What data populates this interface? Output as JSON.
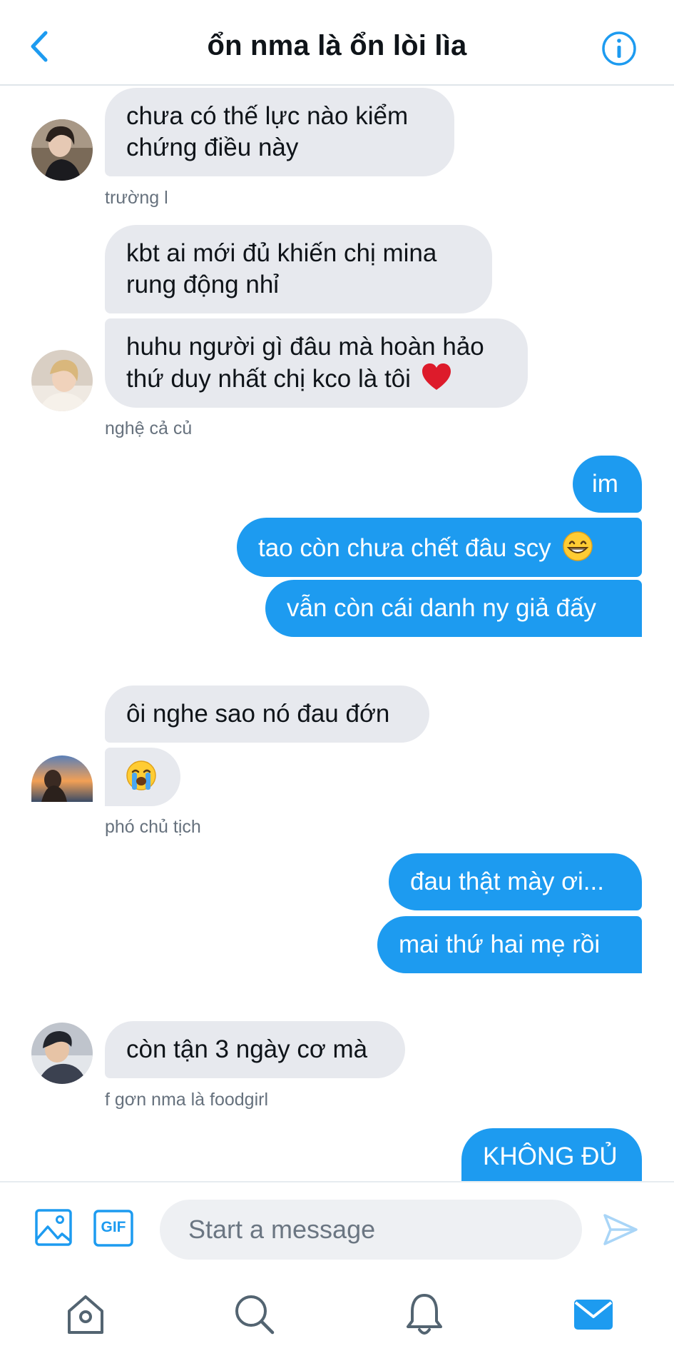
{
  "header": {
    "title": "ổn nma là ổn lòi lìa"
  },
  "messages": {
    "m1_line1": "chưa có thế lực nào kiểm",
    "m1_line2": "chứng điều này",
    "sender1": "trường l",
    "m2_line1": "kbt ai mới đủ khiến chị mina",
    "m2_line2": "rung động nhỉ",
    "m3_line1": "huhu người gì đâu mà hoàn hảo",
    "m3_line2": "thứ duy nhất chị kco là tôi",
    "sender2": "nghệ cả củ",
    "m4": "im",
    "m5": "tao còn chưa chết đâu scy",
    "m6": "vẫn còn cái danh ny giả đấy",
    "m7": "ôi nghe sao nó đau đớn",
    "sender3": "phó chủ tịch",
    "m9": "đau thật mày ơi...",
    "m10": "mai thứ hai mẹ rồi",
    "m11": "còn tận 3 ngày cơ mà",
    "sender4": "f gơn nma là foodgirl",
    "m12": "KHÔNG ĐỦ"
  },
  "composer": {
    "placeholder": "Start a message",
    "gif_label": "GIF"
  },
  "colors": {
    "accent": "#1d9bf0",
    "incoming_bubble": "#e7e9ee",
    "sender_text": "#66717d"
  },
  "icons": {
    "back": "chevron-left-icon",
    "info": "info-icon",
    "image": "image-icon",
    "gif": "gif-icon",
    "send": "send-icon",
    "home": "home-icon",
    "search": "search-icon",
    "notifications": "bell-icon",
    "messages": "mail-icon"
  }
}
